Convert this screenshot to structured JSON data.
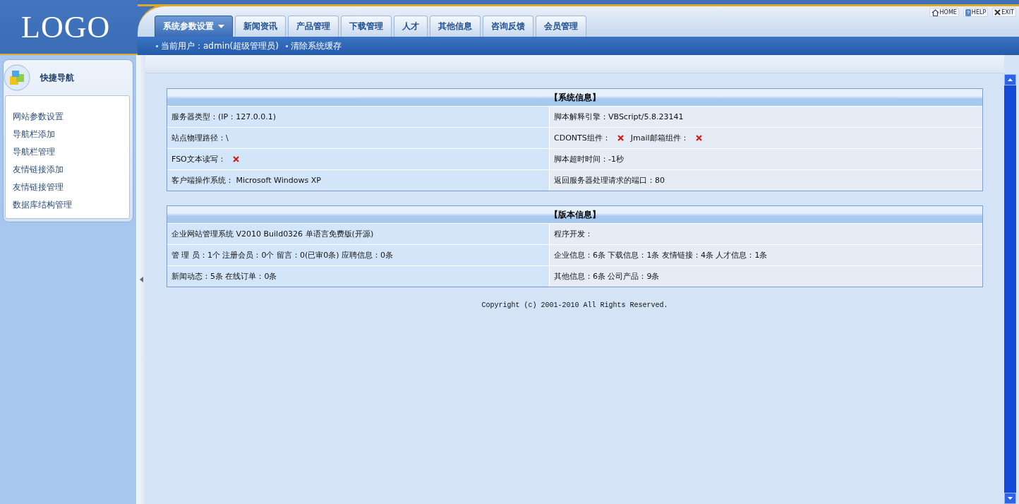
{
  "logo": "LOGO",
  "top_links": [
    {
      "label": "HOME",
      "kind": "home"
    },
    {
      "label": "HELP",
      "kind": "help"
    },
    {
      "label": "EXIT",
      "kind": "exit"
    }
  ],
  "tabs": [
    {
      "label": "系统参数设置",
      "selected": true,
      "dropdown": true
    },
    {
      "label": "新闻资讯",
      "selected": false,
      "dropdown": false
    },
    {
      "label": "产品管理",
      "selected": false,
      "dropdown": false
    },
    {
      "label": "下载管理",
      "selected": false,
      "dropdown": false
    },
    {
      "label": "人才",
      "selected": false,
      "dropdown": false
    },
    {
      "label": "其他信息",
      "selected": false,
      "dropdown": false
    },
    {
      "label": "咨询反馈",
      "selected": false,
      "dropdown": false
    },
    {
      "label": "会员管理",
      "selected": false,
      "dropdown": false
    }
  ],
  "sub_bar": [
    "当前用户：admin(超级管理员)",
    "清除系统缓存"
  ],
  "sidebar": {
    "title": "快捷导航",
    "items": [
      "网站参数设置",
      "导航栏添加",
      "导航栏管理",
      "友情链接添加",
      "友情链接管理",
      "数据库结构管理"
    ]
  },
  "panels": [
    {
      "title": "【系统信息】",
      "rows": [
        [
          [
            {
              "label": "服务器类型：(IP：127.0.0.1)"
            }
          ],
          [
            {
              "label": "脚本解释引擎：VBScript/5.8.23141"
            }
          ]
        ],
        [
          [
            {
              "label": "站点物理路径：\\"
            }
          ],
          [
            {
              "label": "CDONTS组件：",
              "supported": false
            },
            {
              "label": "Jmail邮箱组件：",
              "supported": false
            }
          ]
        ],
        [
          [
            {
              "label": "FSO文本读写：",
              "supported": false
            }
          ],
          [
            {
              "label": "脚本超时时间：-1秒"
            }
          ]
        ],
        [
          [
            {
              "label": "客户端操作系统： Microsoft Windows XP"
            }
          ],
          [
            {
              "label": "返回服务器处理请求的端口：80"
            }
          ]
        ]
      ]
    },
    {
      "title": "【版本信息】",
      "rows": [
        [
          [
            {
              "label": "企业网站管理系统 V2010 Build0326 单语言免费版(开源)"
            }
          ],
          [
            {
              "label": "程序开发："
            }
          ]
        ],
        [
          [
            {
              "label": "管 理 员：1个 注册会员：0个 留言：0(已审0条) 应聘信息：0条"
            }
          ],
          [
            {
              "label": "企业信息：6条 下载信息：1条 友情链接：4条 人才信息：1条"
            }
          ]
        ],
        [
          [
            {
              "label": "新闻动态：5条 在线订单：0条"
            }
          ],
          [
            {
              "label": "其他信息：6条 公司产品：9条"
            }
          ]
        ]
      ]
    }
  ],
  "copyright": "Copyright (c) 2001-2010 All Rights Reserved."
}
